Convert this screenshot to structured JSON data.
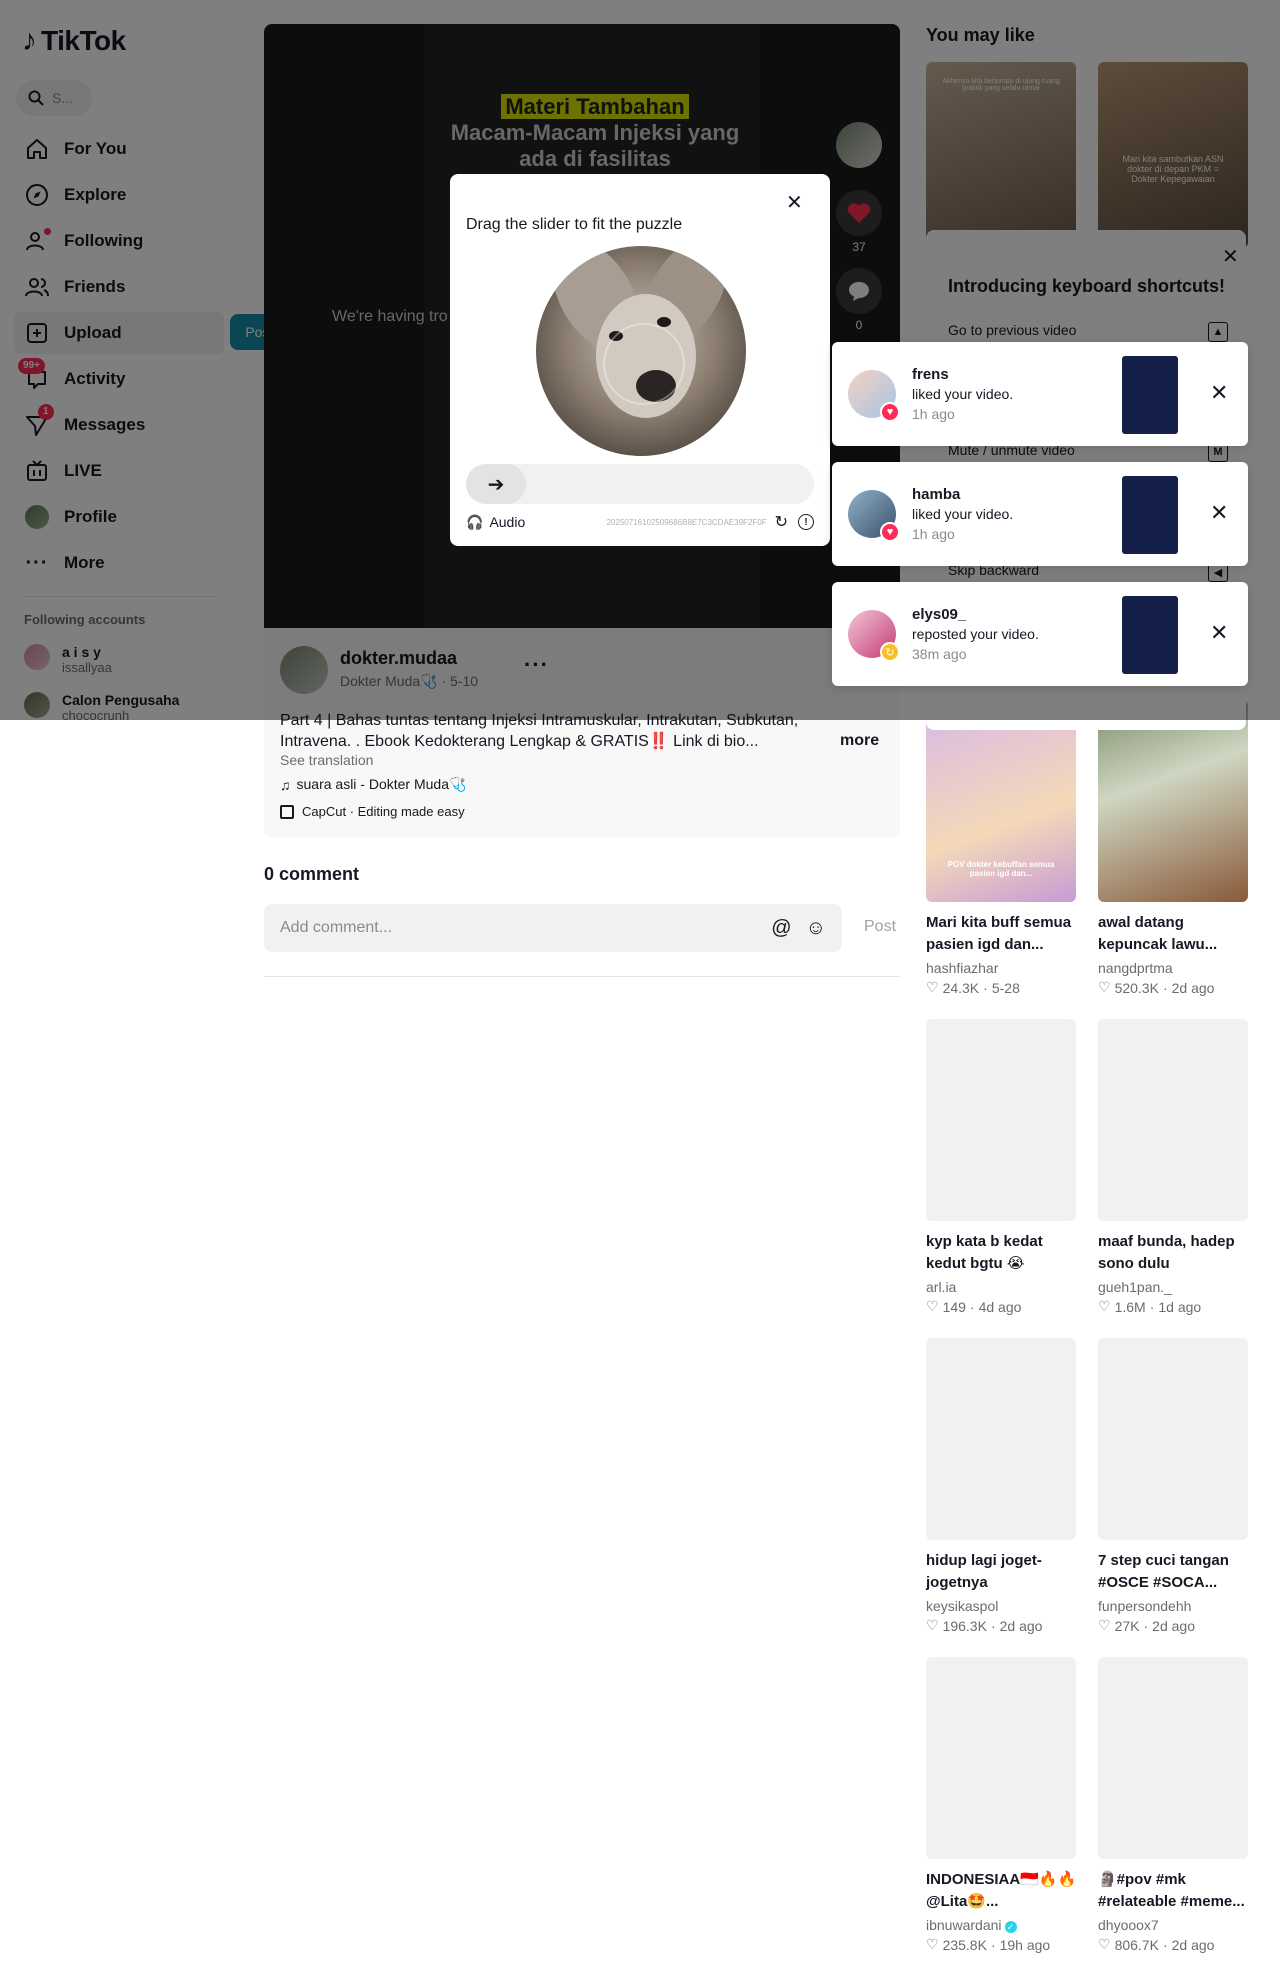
{
  "brand": {
    "name": "TikTok"
  },
  "search": {
    "placeholder": "S..."
  },
  "nav": [
    {
      "label": "For You",
      "icon": "home-icon"
    },
    {
      "label": "Explore",
      "icon": "compass-icon"
    },
    {
      "label": "Following",
      "icon": "following-icon"
    },
    {
      "label": "Friends",
      "icon": "friends-icon"
    },
    {
      "label": "Upload",
      "icon": "upload-icon"
    },
    {
      "label": "Activity",
      "icon": "inbox-icon",
      "badge": "99+"
    },
    {
      "label": "Messages",
      "icon": "send-icon",
      "badge": "1"
    },
    {
      "label": "LIVE",
      "icon": "live-icon"
    },
    {
      "label": "Profile",
      "icon": "avatar"
    },
    {
      "label": "More",
      "icon": "more-icon"
    }
  ],
  "upload_tooltip": "Post video",
  "following_accounts": {
    "title": "Following accounts",
    "items": [
      {
        "name": "a i s y",
        "handle": "issallyaa"
      },
      {
        "name": "Calon Pengusaha",
        "handle": "chococrunh"
      }
    ]
  },
  "video": {
    "title_line1": "Materi Tambahan",
    "title_line2": "Macam-Macam Injeksi yang ada di fasilitas",
    "error_text": "We're having tro",
    "likes": "37",
    "comments": "0"
  },
  "post": {
    "author": "dokter.mudaa",
    "author_sub": "Dokter Muda🩺 · 5-10",
    "description": "Part 4 | Bahas tuntas tentang Injeksi Intramuskular, Intrakutan, Subkutan, Intravena. . Ebook Kedokterang Lengkap & GRATIS‼️ Link di bio...",
    "more_label": "more",
    "see_translation": "See translation",
    "sound": "suara asli - Dokter Muda🩺",
    "capcut": "CapCut · Editing made easy"
  },
  "comments": {
    "count_label": "0 comment",
    "placeholder": "Add comment...",
    "post_label": "Post"
  },
  "captcha": {
    "title": "Drag the slider to fit the puzzle",
    "audio_label": "Audio",
    "id": "20250716102509686B8E7C3CDAE39F2F0F"
  },
  "shortcuts": {
    "title": "Introducing keyboard shortcuts!",
    "rows": [
      {
        "label": "Go to previous video",
        "key": "▲"
      },
      {
        "label": "Mute / unmute video",
        "key": "M"
      },
      {
        "label": "Skip backward",
        "key": "◀"
      }
    ]
  },
  "notifications": [
    {
      "name": "frens",
      "action": "liked your video.",
      "time": "1h ago",
      "type": "like",
      "color": "#fe2c55"
    },
    {
      "name": "hamba",
      "action": "liked your video.",
      "time": "1h ago",
      "type": "like",
      "color": "#fe2c55"
    },
    {
      "name": "elys09_",
      "action": "reposted your video.",
      "time": "38m ago",
      "type": "repost",
      "color": "#fbbf24"
    }
  ],
  "you_may_like": {
    "title": "You may like",
    "top_thumbs": [
      {
        "caption": "Akhirnya kita berjumpa di ujung ruang praktik yang selalu ramai"
      },
      {
        "caption": "Mari kita sambutkan ASN dokter di depan PKM = Dokter Kepegawaian"
      }
    ],
    "items": [
      {
        "title": "Mari kita buff semua pasien igd dan...",
        "user": "hashfiazhar",
        "likes": "24.3K",
        "date": "5-28",
        "thumb_caption": "POV dokter kebuffan semua pasien igd dan..."
      },
      {
        "title": "awal datang kepuncak lawu...",
        "user": "nangdprtma",
        "likes": "520.3K",
        "date": "2d ago"
      },
      {
        "title": "kyp kata b kedat kedut bgtu 😭",
        "user": "arl.ia",
        "likes": "149",
        "date": "4d ago"
      },
      {
        "title": "maaf bunda, hadep sono dulu",
        "user": "gueh1pan._",
        "likes": "1.6M",
        "date": "1d ago"
      },
      {
        "title": "hidup lagi joget-jogetnya",
        "user": "keysikaspol",
        "likes": "196.3K",
        "date": "2d ago"
      },
      {
        "title": "7 step cuci tangan #OSCE #SOCA...",
        "user": "funpersondehh",
        "likes": "27K",
        "date": "2d ago"
      },
      {
        "title": "INDONESIAA🇮🇩🔥🔥@Lita🤩...",
        "user": "ibnuwardani",
        "likes": "235.8K",
        "date": "19h ago",
        "verified": true
      },
      {
        "title": "🗿#pov #mk #relateable #meme...",
        "user": "dhyooox7",
        "likes": "806.7K",
        "date": "2d ago"
      }
    ]
  }
}
